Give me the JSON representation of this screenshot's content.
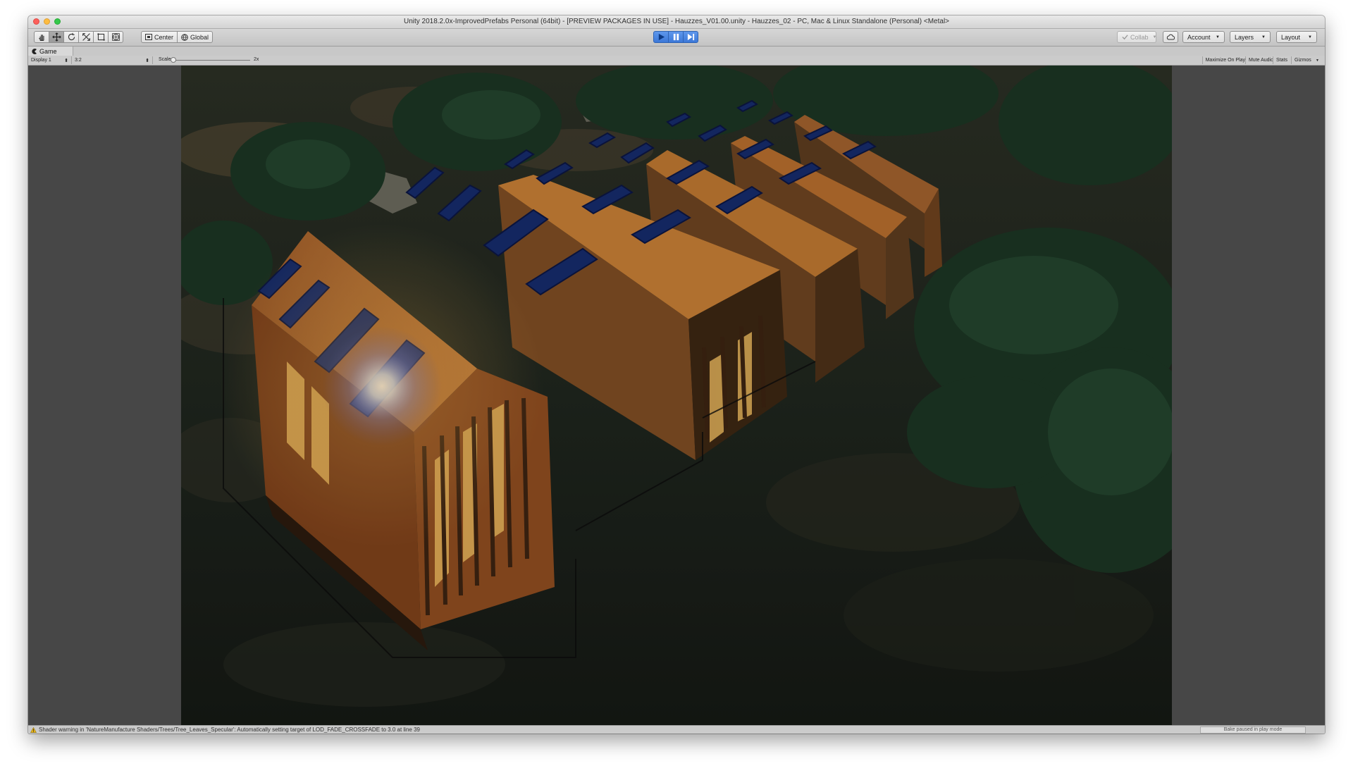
{
  "window": {
    "title": "Unity 2018.2.0x-ImprovedPrefabs Personal (64bit) - [PREVIEW PACKAGES IN USE] - Hauzzes_V01.00.unity - Hauzzes_02 - PC, Mac & Linux Standalone (Personal) <Metal>"
  },
  "toolbar": {
    "tools": [
      "hand-tool-icon",
      "move-tool-icon",
      "rotate-tool-icon",
      "scale-tool-icon",
      "rect-tool-icon",
      "transform-tool-icon"
    ],
    "pivot_label": "Center",
    "space_label": "Global",
    "collab_label": "Collab",
    "account_label": "Account",
    "layers_label": "Layers",
    "layout_label": "Layout"
  },
  "game_view": {
    "tab_label": "Game",
    "display_label": "Display 1",
    "aspect_label": "3:2",
    "scale_label": "Scale",
    "scale_value": "2x",
    "scale_fraction": 0,
    "maximize_label": "Maximize On Play",
    "mute_label": "Mute Audio",
    "stats_label": "Stats",
    "gizmos_label": "Gizmos"
  },
  "status": {
    "warning_text": "Shader warning in 'NatureManufacture Shaders/Trees/Tree_Leaves_Specular': Automatically setting target of LOD_FADE_CROSSFADE to 3.0 at line 39",
    "bake_text": "Bake paused in play mode"
  },
  "colors": {
    "play_accent": "#3c78d8",
    "cabin_orange": "#b06a2c",
    "solar_panel_blue": "#142a6b"
  }
}
